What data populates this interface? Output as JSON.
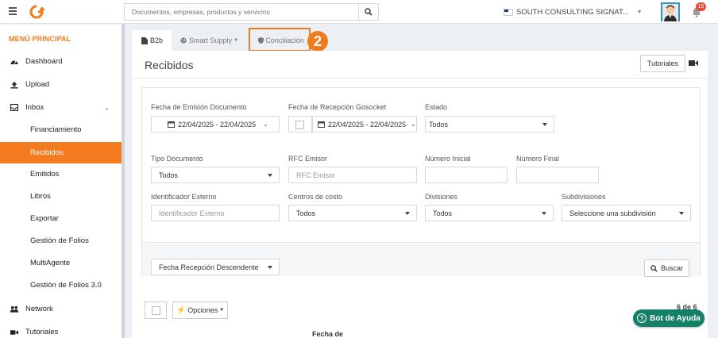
{
  "topbar": {
    "search_placeholder": "Documentos, empresas, productos y servicios",
    "company_name": "SOUTH CONSULTING SIGNAT...",
    "notification_count": "15"
  },
  "sidebar": {
    "title": "MENÚ PRINCIPAL",
    "items": [
      {
        "label": "Dashboard",
        "icon": "dashboard-icon"
      },
      {
        "label": "Upload",
        "icon": "upload-icon"
      },
      {
        "label": "Inbox",
        "icon": "inbox-icon"
      },
      {
        "label": "Network",
        "icon": "network-icon"
      },
      {
        "label": "Tutoriales",
        "icon": "video-icon"
      }
    ],
    "inbox_sub": [
      "Financiamiento",
      "Recibidos",
      "Emitidos",
      "Libros",
      "Exportar",
      "Gestión de Folios",
      "MultiAgente",
      "Gestión de Folios 3.0"
    ],
    "active_sub": "Recibidos"
  },
  "tabs": {
    "b2b": "B2b",
    "smart_supply": "Smart Supply",
    "conciliacion": "Conciliación",
    "step_number": "2"
  },
  "page": {
    "title": "Recibidos",
    "tutoriales_label": "Tutoriales"
  },
  "filters": {
    "fecha_emision_label": "Fecha de Emisión Documento",
    "fecha_emision_value": "22/04/2025 - 22/04/2025",
    "fecha_recepcion_label": "Fecha de Recepción Gosocket",
    "fecha_recepcion_value": "22/04/2025 - 22/04/2025",
    "estado_label": "Estado",
    "estado_value": "Todos",
    "tipo_doc_label": "Tipo Documento",
    "tipo_doc_value": "Todos",
    "rfc_label": "RFC Emisor",
    "rfc_placeholder": "RFC Emisor",
    "num_inicial_label": "Número Inicial",
    "num_final_label": "Número Final",
    "ident_ext_label": "Identificador Externo",
    "ident_ext_placeholder": "Identificador Externo",
    "centros_label": "Centros de costo",
    "centros_value": "Todos",
    "divisiones_label": "Divisiones",
    "divisiones_value": "Todos",
    "subdivisiones_label": "Subdivisiones",
    "subdivisiones_value": "Seleccione una subdivisión",
    "orden_value": "Fecha Recepción Descendente",
    "buscar_label": "Buscar"
  },
  "list": {
    "opciones_label": "Opciones",
    "count": "6 de 6",
    "column_header": "Fecha de"
  },
  "help": {
    "bot_label": "Bot de Ayuda"
  },
  "colors": {
    "accent": "#f07c20",
    "active_nav": "#f47b20",
    "bot": "#148066"
  }
}
